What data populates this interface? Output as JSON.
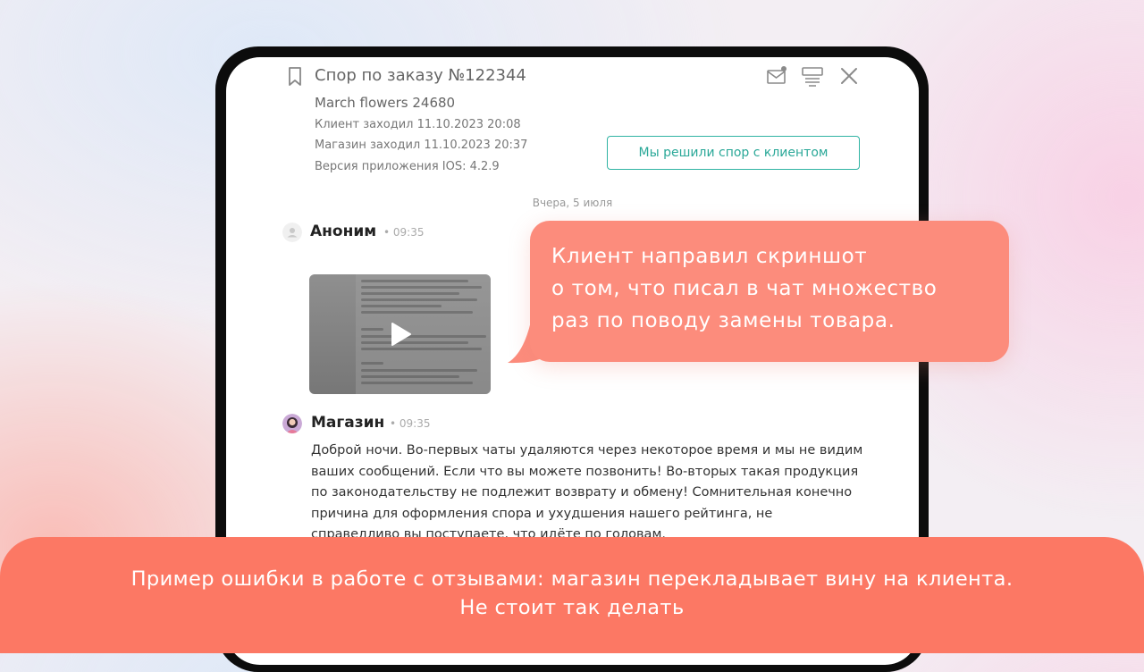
{
  "dispute": {
    "title": "Спор по заказу №122344",
    "store_name": "March flowers 24680",
    "client_visit": "Клиент заходил 11.10.2023 20:08",
    "store_visit": "Магазин заходил 11.10.2023 20:37",
    "app_version": "Версия приложения IOS: 4.2.9",
    "resolve_button": "Мы решили спор с клиентом"
  },
  "icons": {
    "bookmark": "bookmark-icon",
    "mail": "mail-notification-icon",
    "template": "template-icon",
    "close": "close-icon",
    "play": "play-icon"
  },
  "chat": {
    "date_separator": "Вчера, 5 июля",
    "messages": [
      {
        "author": "Аноним",
        "time": "• 09:35",
        "attachment": "video"
      },
      {
        "author": "Магазин",
        "time": "• 09:35",
        "text": "Доброй ночи. Во-первых чаты удаляются через некоторое время и мы не видим ваших сообщений. Если что вы можете позвонить! Во-вторых такая продукция по законодательству не подлежит возврату и обмену! Сомнительная конечно причина для оформления спора и ухудшения нашего рейтинга, не справедливо вы поступаете, что идёте по головам."
      }
    ]
  },
  "callout": {
    "line1": "Клиент направил скриншот",
    "line2": "о том, что писал в чат множество",
    "line3": "раз по поводу замены товара."
  },
  "caption": {
    "line1": "Пример ошибки в работе с отзывами: магазин перекладывает вину на клиента.",
    "line2": "Не стоит так делать"
  },
  "colors": {
    "accent_teal": "#2fb3a3",
    "callout": "#fc8c7c",
    "banner": "#fc7864"
  }
}
